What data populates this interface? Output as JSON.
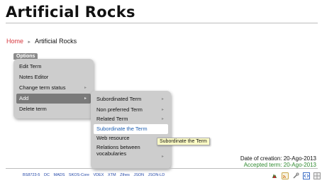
{
  "page": {
    "title": "Artificial Rocks"
  },
  "breadcrumb": {
    "home": "Home",
    "separator": "▸",
    "current": "Artificial Rocks"
  },
  "options": {
    "tab_label": "Options",
    "menu": [
      {
        "label": "Edit Term",
        "arrow": ""
      },
      {
        "label": "Notes Editor",
        "arrow": ""
      },
      {
        "label": "Change term status",
        "arrow": "▸"
      },
      {
        "label": "Add",
        "arrow": "▸",
        "state": "selected"
      },
      {
        "label": "Delete term",
        "arrow": ""
      }
    ]
  },
  "add_submenu": [
    {
      "label": "Subordinated Term",
      "arrow": "▸"
    },
    {
      "label": "Non preferred Term",
      "arrow": "▸"
    },
    {
      "label": "Related Term",
      "arrow": "▸"
    },
    {
      "label": "Subordinate the Term",
      "arrow": "",
      "state": "hover"
    },
    {
      "label": "Web resource",
      "arrow": ""
    },
    {
      "label": "Relations between vocabularies",
      "arrow": "▸"
    }
  ],
  "tooltip": "Subordinate the Term",
  "dates": {
    "created": "Date of creation: 20-Ago-2013",
    "accepted": "Accepted term: 20-Ago-2013"
  },
  "footer": {
    "links": [
      "BS8723-5",
      "DC",
      "MADS",
      "SKOS-Core",
      "VDEX",
      "XTM",
      "Zthes",
      "JSON",
      "JSON-LD"
    ],
    "icons": [
      "tree-icon",
      "rss-icon",
      "tool-icon",
      "code-icon",
      "grid-icon"
    ]
  },
  "colors": {
    "breadcrumb_home": "#d6373d",
    "accepted": "#2f8a2f",
    "link": "#2448a8"
  }
}
